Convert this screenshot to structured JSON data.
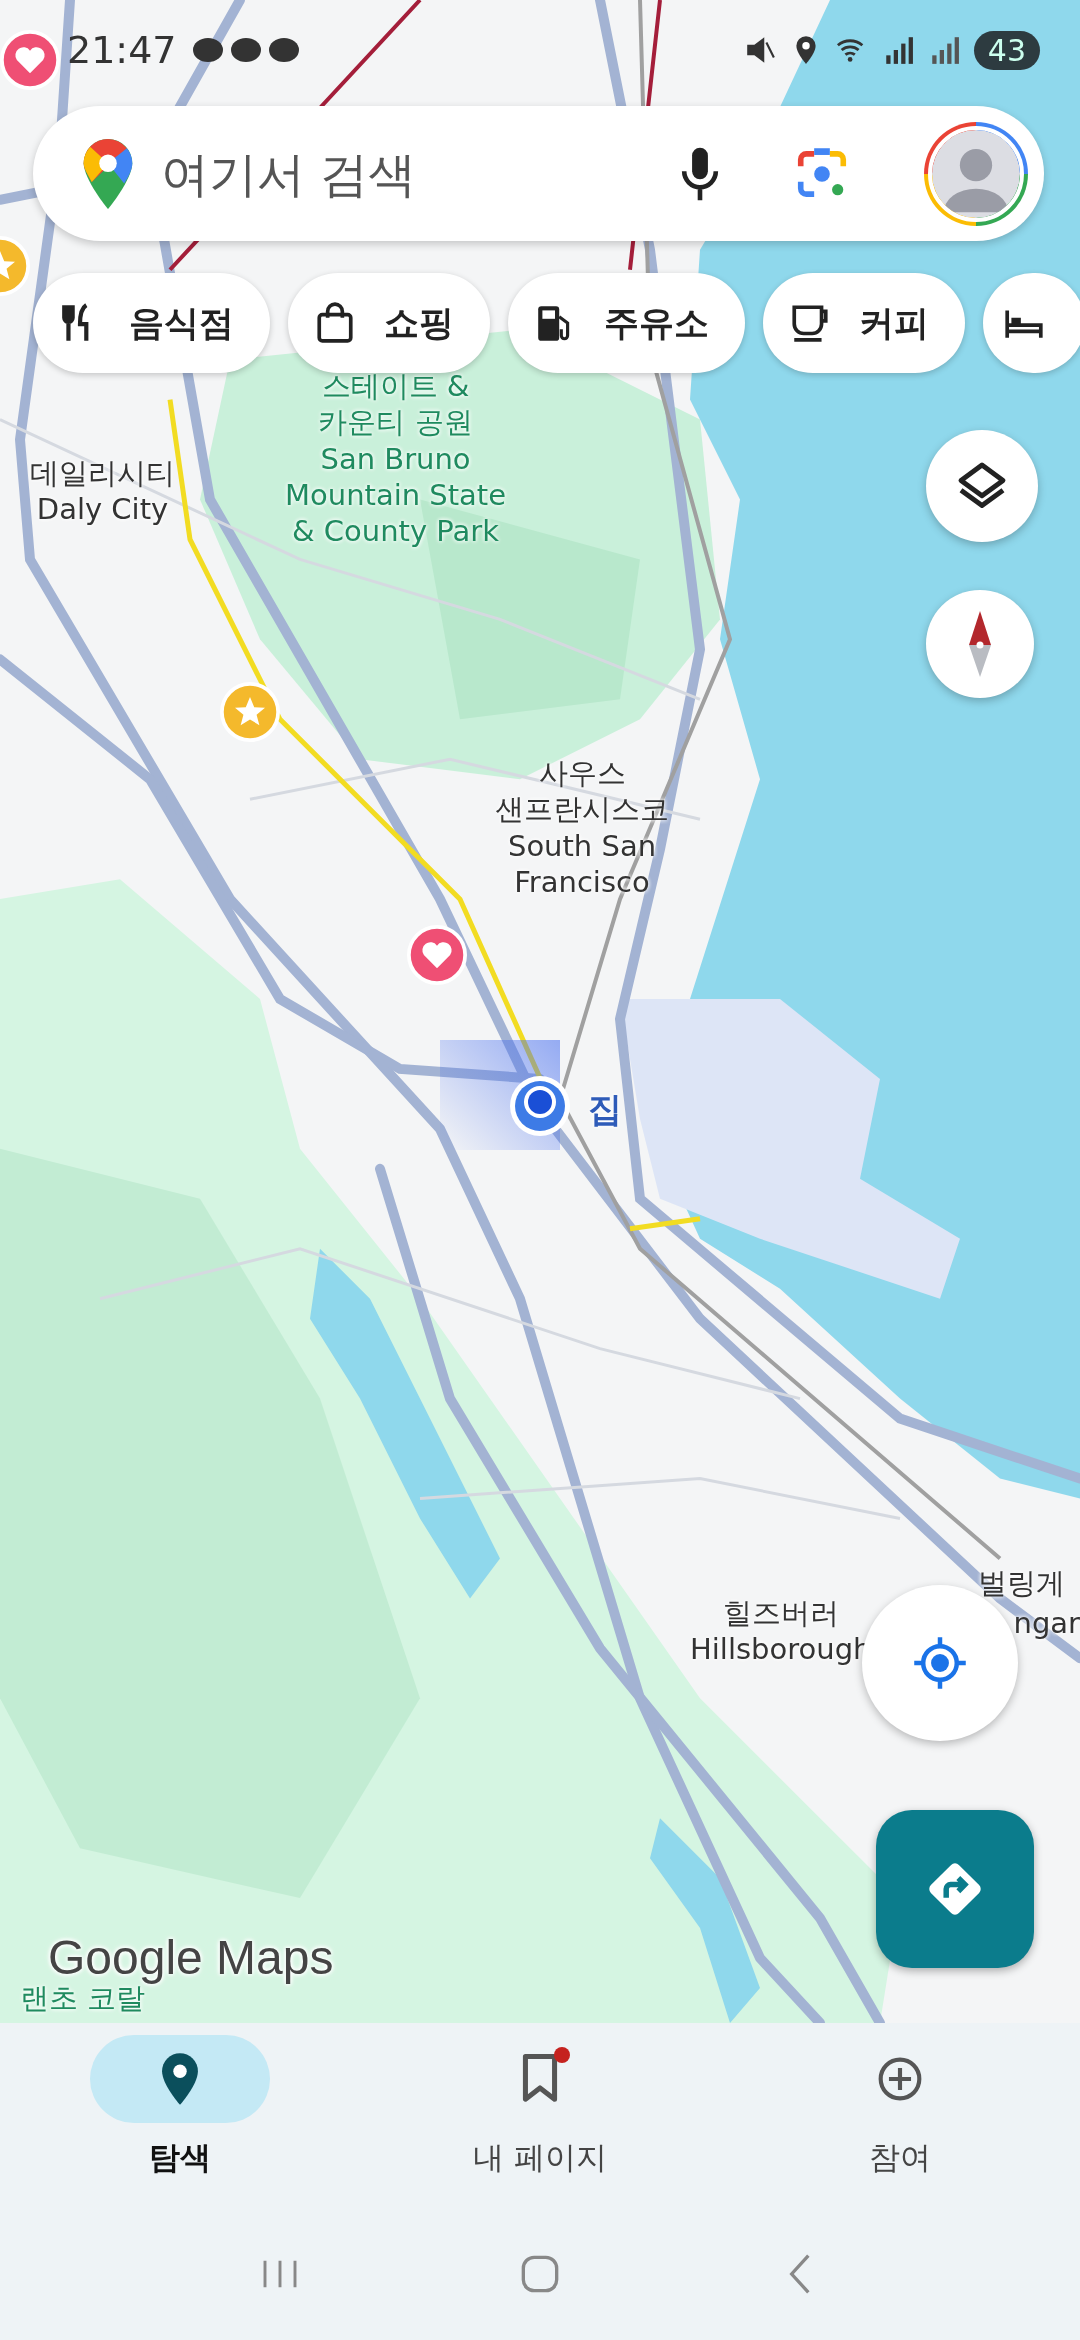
{
  "status_bar": {
    "time": "21:47",
    "battery": "43"
  },
  "search": {
    "placeholder": "여기서 검색"
  },
  "categories": [
    {
      "label": "음식점",
      "kind": "restaurant"
    },
    {
      "label": "쇼핑",
      "kind": "shopping"
    },
    {
      "label": "주유소",
      "kind": "gas"
    },
    {
      "label": "커피",
      "kind": "coffee"
    },
    {
      "kind": "hotel"
    }
  ],
  "map": {
    "labels": [
      {
        "kind": "city",
        "lines": [
          "데일리시티",
          "Daly City"
        ]
      },
      {
        "kind": "park",
        "lines": [
          "스테이트 &",
          "카운티 공원",
          "San Bruno",
          "Mountain State",
          "& County Park"
        ]
      },
      {
        "kind": "city",
        "lines": [
          "사우스",
          "샌프란시스코",
          "South San",
          "Francisco"
        ]
      },
      {
        "kind": "home",
        "lines": [
          "집"
        ]
      },
      {
        "kind": "city",
        "lines": [
          "힐즈버러",
          "Hillsborough"
        ]
      },
      {
        "kind": "city",
        "lines": [
          "벌링게"
        ]
      },
      {
        "kind": "city",
        "lines": [
          "ngar"
        ]
      },
      {
        "kind": "park",
        "lines": [
          "랜초 코랄"
        ]
      }
    ],
    "pins": [
      {
        "kind": "heart"
      },
      {
        "kind": "star"
      },
      {
        "kind": "star"
      },
      {
        "kind": "heart"
      }
    ],
    "logo": "Google Maps"
  },
  "nav": [
    {
      "label": "탐색",
      "kind": "explore",
      "selected": true,
      "badge": false
    },
    {
      "label": "내 페이지",
      "kind": "saved",
      "selected": false,
      "badge": true
    },
    {
      "label": "참여",
      "kind": "contribute",
      "selected": false,
      "badge": false
    }
  ]
}
